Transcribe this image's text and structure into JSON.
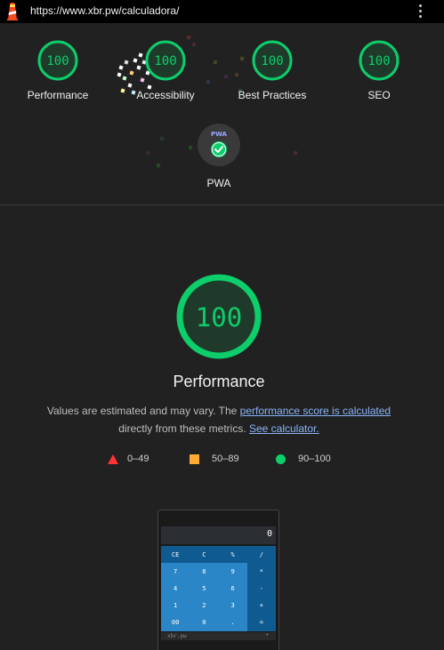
{
  "browser": {
    "url": "https://www.xbr.pw/calculadora/"
  },
  "summary": {
    "gauges": [
      {
        "score": "100",
        "label": "Performance"
      },
      {
        "score": "100",
        "label": "Accessibility"
      },
      {
        "score": "100",
        "label": "Best Practices"
      },
      {
        "score": "100",
        "label": "SEO"
      }
    ],
    "pwa": {
      "badge_text": "PWA",
      "label": "PWA"
    }
  },
  "performance": {
    "score": "100",
    "title": "Performance",
    "desc_prefix": "Values are estimated and may vary. The ",
    "desc_link1": "performance score is calculated",
    "desc_middle": " directly from these metrics. ",
    "desc_link2": "See calculator.",
    "legend": {
      "fail": "0–49",
      "average": "50–89",
      "pass": "90–100"
    }
  },
  "colors": {
    "pass": "#0cce6b",
    "average": "#ffaa33",
    "fail": "#ff3333",
    "link": "#89b4f8",
    "background": "#212121"
  },
  "screenshot": {
    "display": "0",
    "keys": [
      "CE",
      "C",
      "%",
      "/",
      "7",
      "8",
      "9",
      "*",
      "4",
      "5",
      "6",
      "-",
      "1",
      "2",
      "3",
      "+",
      "00",
      "0",
      ".",
      "="
    ],
    "site": "xbr.pw",
    "footer_icon": "+"
  }
}
